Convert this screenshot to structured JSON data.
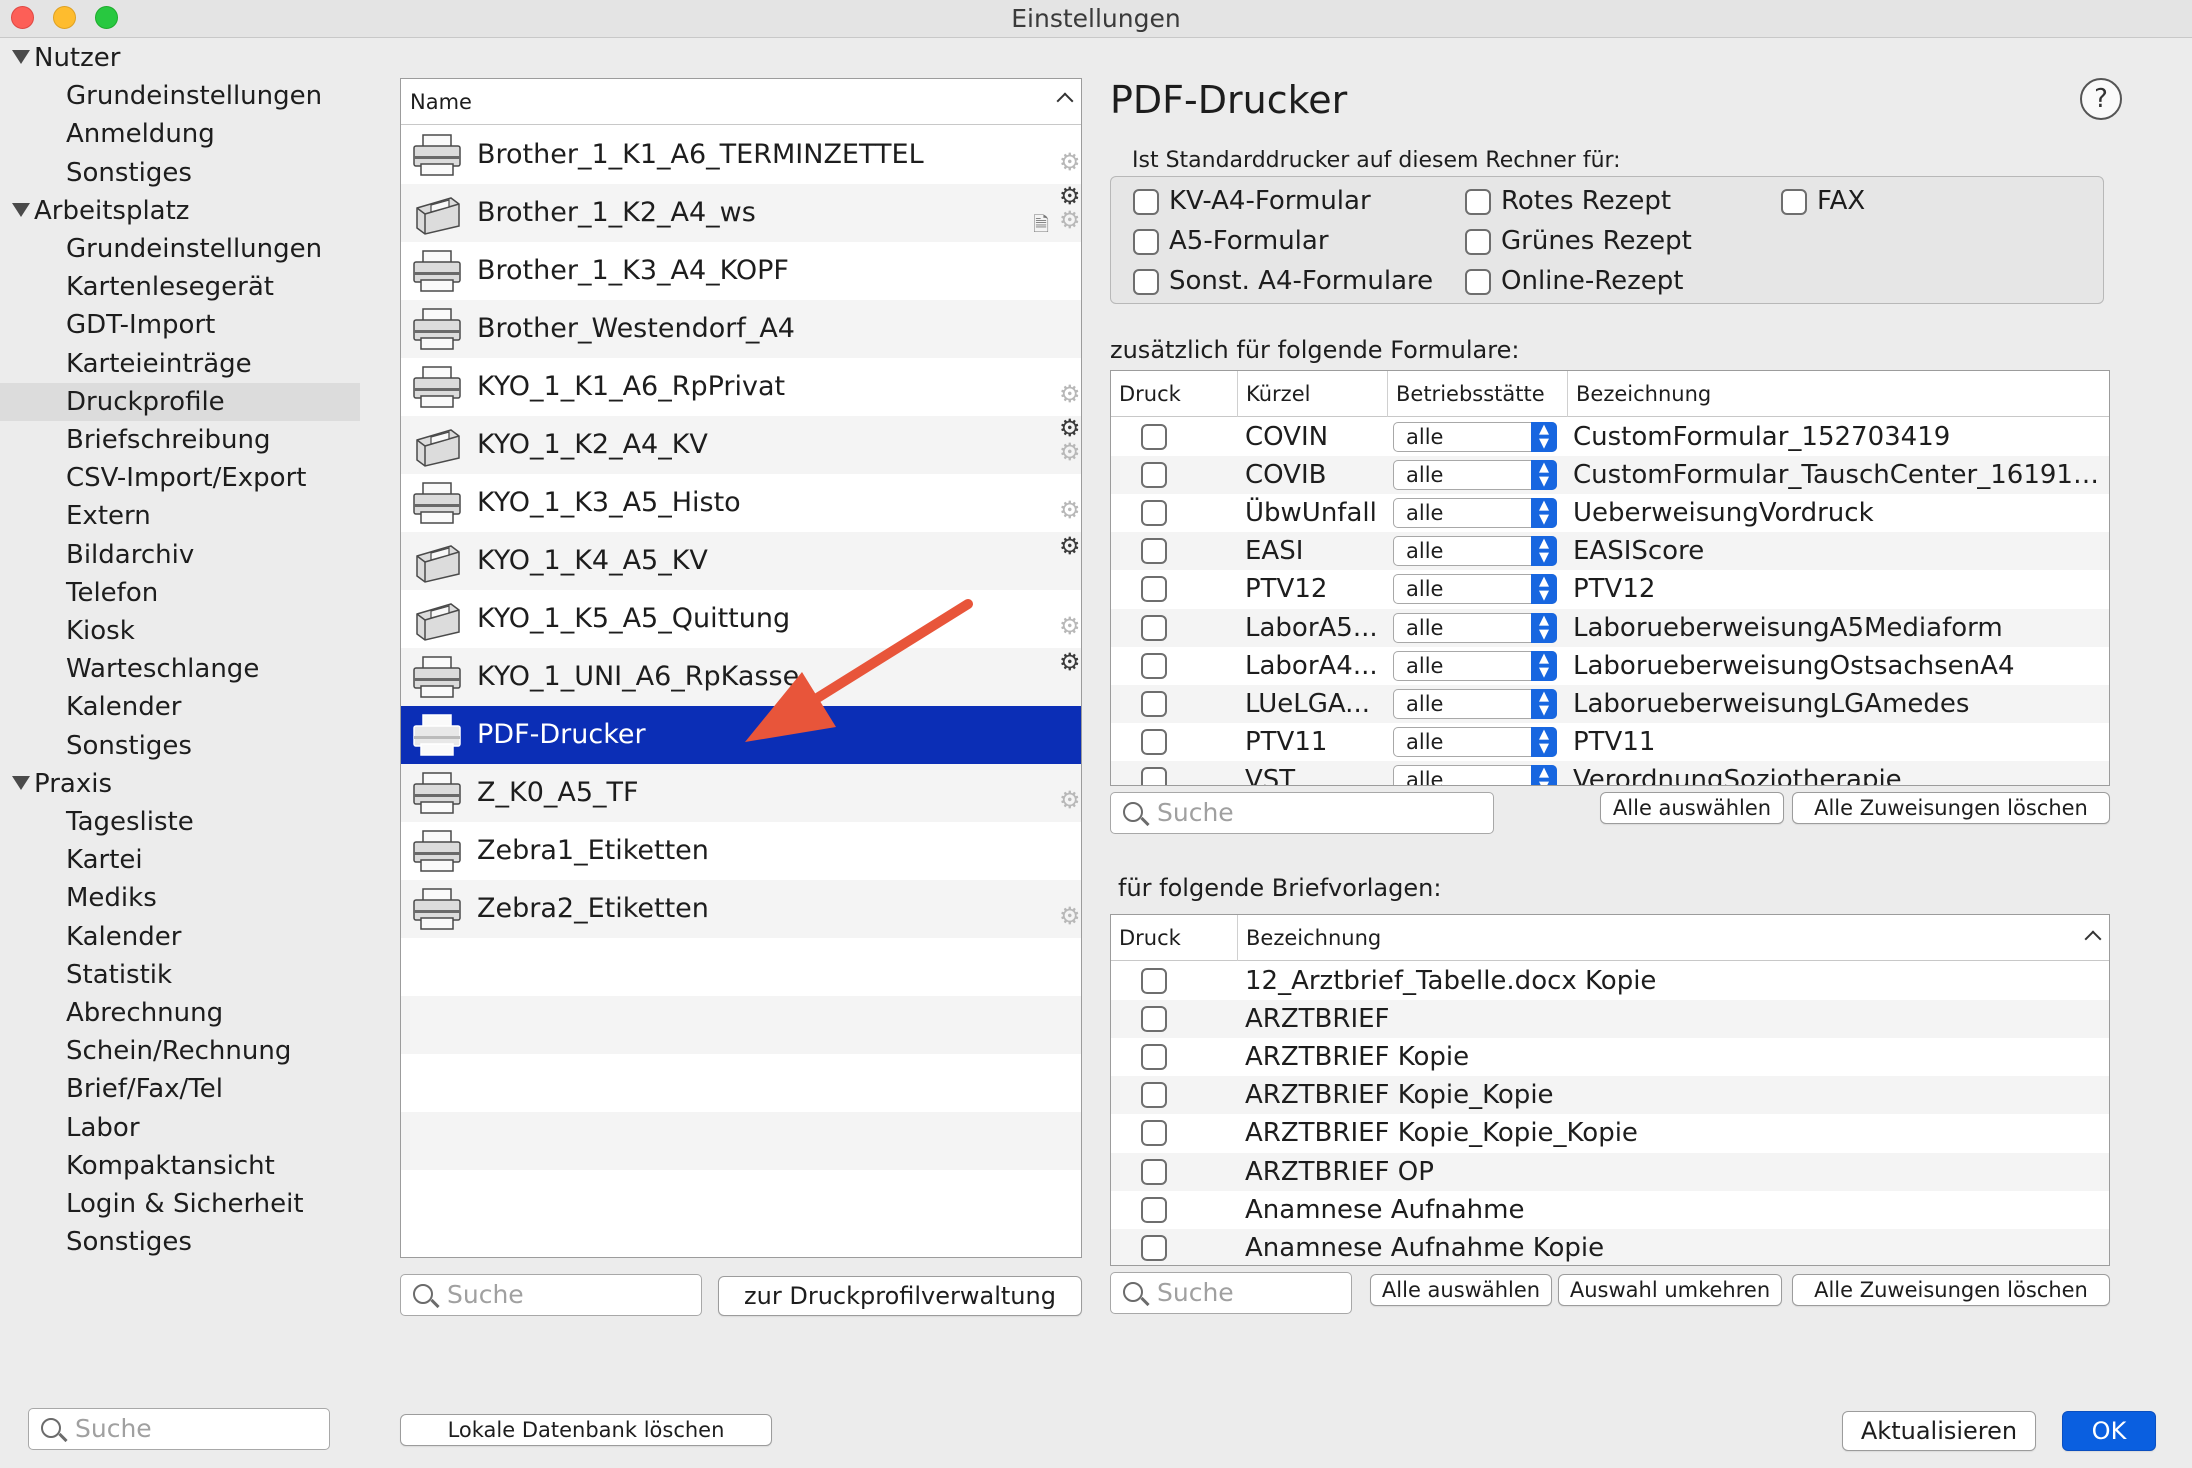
{
  "window": {
    "title": "Einstellungen"
  },
  "sidebar": {
    "items": [
      {
        "label": "Nutzer",
        "type": "group"
      },
      {
        "label": "Grundeinstellungen",
        "type": "child"
      },
      {
        "label": "Anmeldung",
        "type": "child"
      },
      {
        "label": "Sonstiges",
        "type": "child"
      },
      {
        "label": "Arbeitsplatz",
        "type": "group"
      },
      {
        "label": "Grundeinstellungen",
        "type": "child"
      },
      {
        "label": "Kartenlesegerät",
        "type": "child"
      },
      {
        "label": "GDT-Import",
        "type": "child"
      },
      {
        "label": "Karteieinträge",
        "type": "child"
      },
      {
        "label": "Druckprofile",
        "type": "child",
        "selected": true
      },
      {
        "label": "Briefschreibung",
        "type": "child"
      },
      {
        "label": "CSV-Import/Export",
        "type": "child"
      },
      {
        "label": "Extern",
        "type": "child"
      },
      {
        "label": "Bildarchiv",
        "type": "child"
      },
      {
        "label": "Telefon",
        "type": "child"
      },
      {
        "label": "Kiosk",
        "type": "child"
      },
      {
        "label": "Warteschlange",
        "type": "child"
      },
      {
        "label": "Kalender",
        "type": "child"
      },
      {
        "label": "Sonstiges",
        "type": "child"
      },
      {
        "label": "Praxis",
        "type": "group"
      },
      {
        "label": "Tagesliste",
        "type": "child"
      },
      {
        "label": "Kartei",
        "type": "child"
      },
      {
        "label": "Mediks",
        "type": "child"
      },
      {
        "label": "Kalender",
        "type": "child"
      },
      {
        "label": "Statistik",
        "type": "child"
      },
      {
        "label": "Abrechnung",
        "type": "child"
      },
      {
        "label": "Schein/Rechnung",
        "type": "child"
      },
      {
        "label": "Brief/Fax/Tel",
        "type": "child"
      },
      {
        "label": "Labor",
        "type": "child"
      },
      {
        "label": "Kompaktansicht",
        "type": "child"
      },
      {
        "label": "Login & Sicherheit",
        "type": "child"
      },
      {
        "label": "Sonstiges",
        "type": "child"
      }
    ],
    "search_placeholder": "Suche"
  },
  "printer_list": {
    "header": "Name",
    "printers": [
      {
        "name": "Brother_1_K1_A6_TERMINZETTEL",
        "icon": "printer-icon",
        "gears": [
          "light"
        ]
      },
      {
        "name": "Brother_1_K2_A4_ws",
        "icon": "laser-printer-icon",
        "gears": [
          "dark",
          "light"
        ],
        "doc": true
      },
      {
        "name": "Brother_1_K3_A4_KOPF",
        "icon": "printer-icon",
        "gears": []
      },
      {
        "name": "Brother_Westendorf_A4",
        "icon": "printer-icon",
        "gears": []
      },
      {
        "name": "KYO_1_K1_A6_RpPrivat",
        "icon": "printer-icon",
        "gears": [
          "light"
        ]
      },
      {
        "name": "KYO_1_K2_A4_KV",
        "icon": "laser-printer-icon",
        "gears": [
          "dark",
          "light"
        ]
      },
      {
        "name": "KYO_1_K3_A5_Histo",
        "icon": "printer-icon",
        "gears": [
          "light"
        ]
      },
      {
        "name": "KYO_1_K4_A5_KV",
        "icon": "laser-printer-icon",
        "gears": [
          "dark"
        ]
      },
      {
        "name": "KYO_1_K5_A5_Quittung",
        "icon": "laser-printer-icon",
        "gears": [
          "light"
        ]
      },
      {
        "name": "KYO_1_UNI_A6_RpKasse",
        "icon": "printer-icon",
        "gears": [
          "dark"
        ]
      },
      {
        "name": "PDF-Drucker",
        "icon": "printer-icon",
        "gears": [],
        "selected": true
      },
      {
        "name": "Z_K0_A5_TF",
        "icon": "printer-icon",
        "gears": [
          "light"
        ]
      },
      {
        "name": "Zebra1_Etiketten",
        "icon": "printer-icon",
        "gears": []
      },
      {
        "name": "Zebra2_Etiketten",
        "icon": "printer-icon",
        "gears": [
          "light"
        ]
      }
    ],
    "search_placeholder": "Suche",
    "manage_button": "zur Druckprofilverwaltung",
    "delete_db_button": "Lokale Datenbank löschen"
  },
  "detail": {
    "title": "PDF-Drucker",
    "help": "?",
    "default_label": "Ist Standarddrucker auf diesem Rechner für:",
    "default_options": [
      {
        "label": "KV-A4-Formular",
        "checked": false
      },
      {
        "label": "A5-Formular",
        "checked": false
      },
      {
        "label": "Sonst. A4-Formulare",
        "checked": false
      },
      {
        "label": "Rotes Rezept",
        "checked": false
      },
      {
        "label": "Grünes Rezept",
        "checked": false
      },
      {
        "label": "Online-Rezept",
        "checked": false
      },
      {
        "label": "FAX",
        "checked": false
      }
    ],
    "forms_label": "zusätzlich für folgende Formulare:",
    "forms_columns": [
      "Druck",
      "Kürzel",
      "Betriebsstätte",
      "Bezeichnung"
    ],
    "forms": [
      {
        "kuerzel": "COVIN",
        "site": "alle",
        "name": "CustomFormular_152703419"
      },
      {
        "kuerzel": "COVIB",
        "site": "alle",
        "name": "CustomFormular_TauschCenter_16191541..."
      },
      {
        "kuerzel": "ÜbwUnfall",
        "site": "alle",
        "name": "UeberweisungVordruck"
      },
      {
        "kuerzel": "EASI",
        "site": "alle",
        "name": "EASIScore"
      },
      {
        "kuerzel": "PTV12",
        "site": "alle",
        "name": "PTV12"
      },
      {
        "kuerzel": "LaborA5...",
        "site": "alle",
        "name": "LaborueberweisungA5Mediaform"
      },
      {
        "kuerzel": "LaborA4...",
        "site": "alle",
        "name": "LaborueberweisungOstsachsenA4"
      },
      {
        "kuerzel": "LUeLGA...",
        "site": "alle",
        "name": "LaborueberweisungLGAmedes"
      },
      {
        "kuerzel": "PTV11",
        "site": "alle",
        "name": "PTV11"
      },
      {
        "kuerzel": "VST",
        "site": "alle",
        "name": "VerordnungSoziotherapie"
      }
    ],
    "forms_search_placeholder": "Suche",
    "forms_select_all": "Alle auswählen",
    "forms_clear_all": "Alle Zuweisungen löschen",
    "letters_label": "für folgende Briefvorlagen:",
    "letters_columns": [
      "Druck",
      "Bezeichnung"
    ],
    "letters": [
      "12_Arztbrief_Tabelle.docx Kopie",
      "ARZTBRIEF",
      "ARZTBRIEF Kopie",
      "ARZTBRIEF Kopie_Kopie",
      "ARZTBRIEF Kopie_Kopie_Kopie",
      "ARZTBRIEF OP",
      "Anamnese Aufnahme",
      "Anamnese Aufnahme Kopie"
    ],
    "letters_search_placeholder": "Suche",
    "letters_select_all": "Alle auswählen",
    "letters_invert": "Auswahl umkehren",
    "letters_clear_all": "Alle Zuweisungen löschen"
  },
  "footer": {
    "refresh_button": "Aktualisieren",
    "ok_button": "OK"
  },
  "colors": {
    "selection": "#0b2eb6",
    "accent": "#0a5fe0",
    "annotation_arrow": "#e8553a"
  }
}
